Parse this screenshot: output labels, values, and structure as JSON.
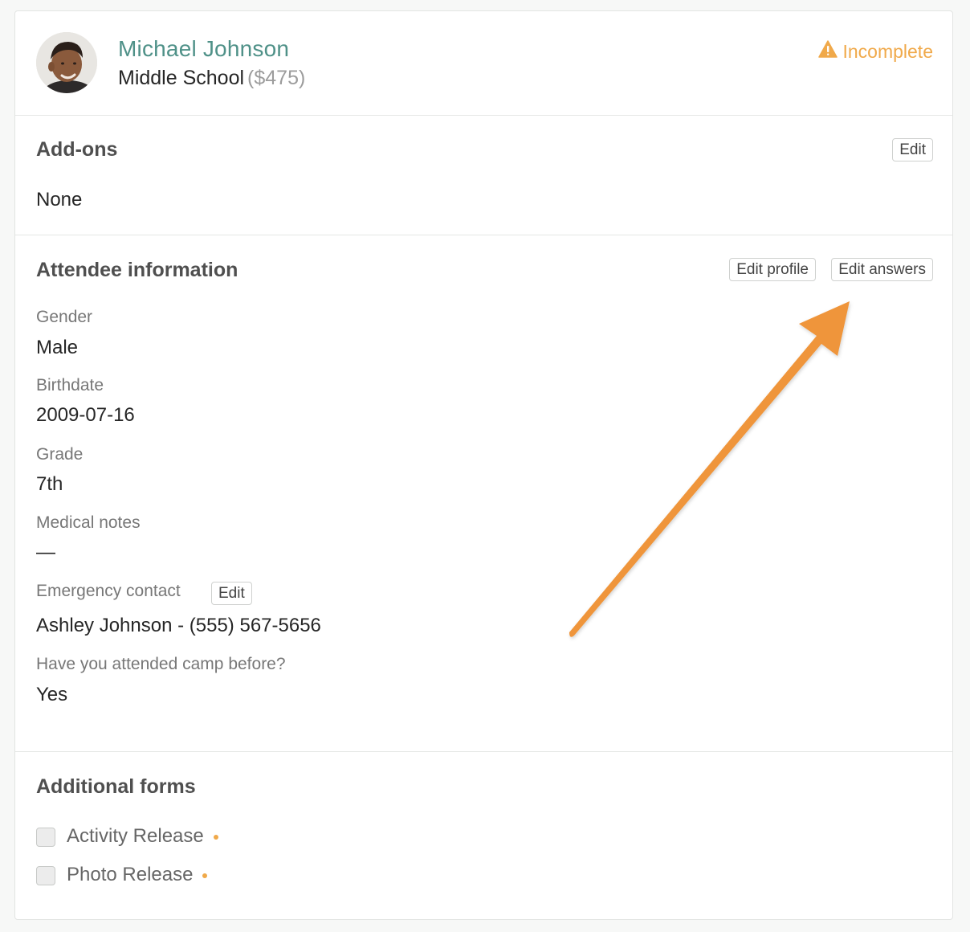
{
  "colors": {
    "name": "#4f9188",
    "incomplete": "#f0a94a",
    "arrow": "#ef953a"
  },
  "header": {
    "avatar_icon": "avatar-photo",
    "name": "Michael Johnson",
    "program": "Middle School",
    "price": "($475)",
    "status_icon": "warning-icon",
    "status": "Incomplete"
  },
  "addons": {
    "title": "Add-ons",
    "edit_label": "Edit",
    "value": "None"
  },
  "attendee": {
    "title": "Attendee information",
    "edit_profile_label": "Edit profile",
    "edit_answers_label": "Edit answers",
    "fields": [
      {
        "label": "Gender",
        "value": "Male"
      },
      {
        "label": "Birthdate",
        "value": "2009-07-16"
      },
      {
        "label": "Grade",
        "value": "7th"
      },
      {
        "label": "Medical notes",
        "value": "—"
      },
      {
        "label": "Emergency contact",
        "value": "Ashley Johnson - (555) 567-5656",
        "edit_label": "Edit"
      },
      {
        "label": "Have you attended camp before?",
        "value": "Yes"
      }
    ]
  },
  "forms": {
    "title": "Additional forms",
    "items": [
      {
        "label": "Activity Release",
        "checked": false
      },
      {
        "label": "Photo Release",
        "checked": false
      }
    ]
  },
  "annotation": {
    "icon": "arrow-icon"
  }
}
